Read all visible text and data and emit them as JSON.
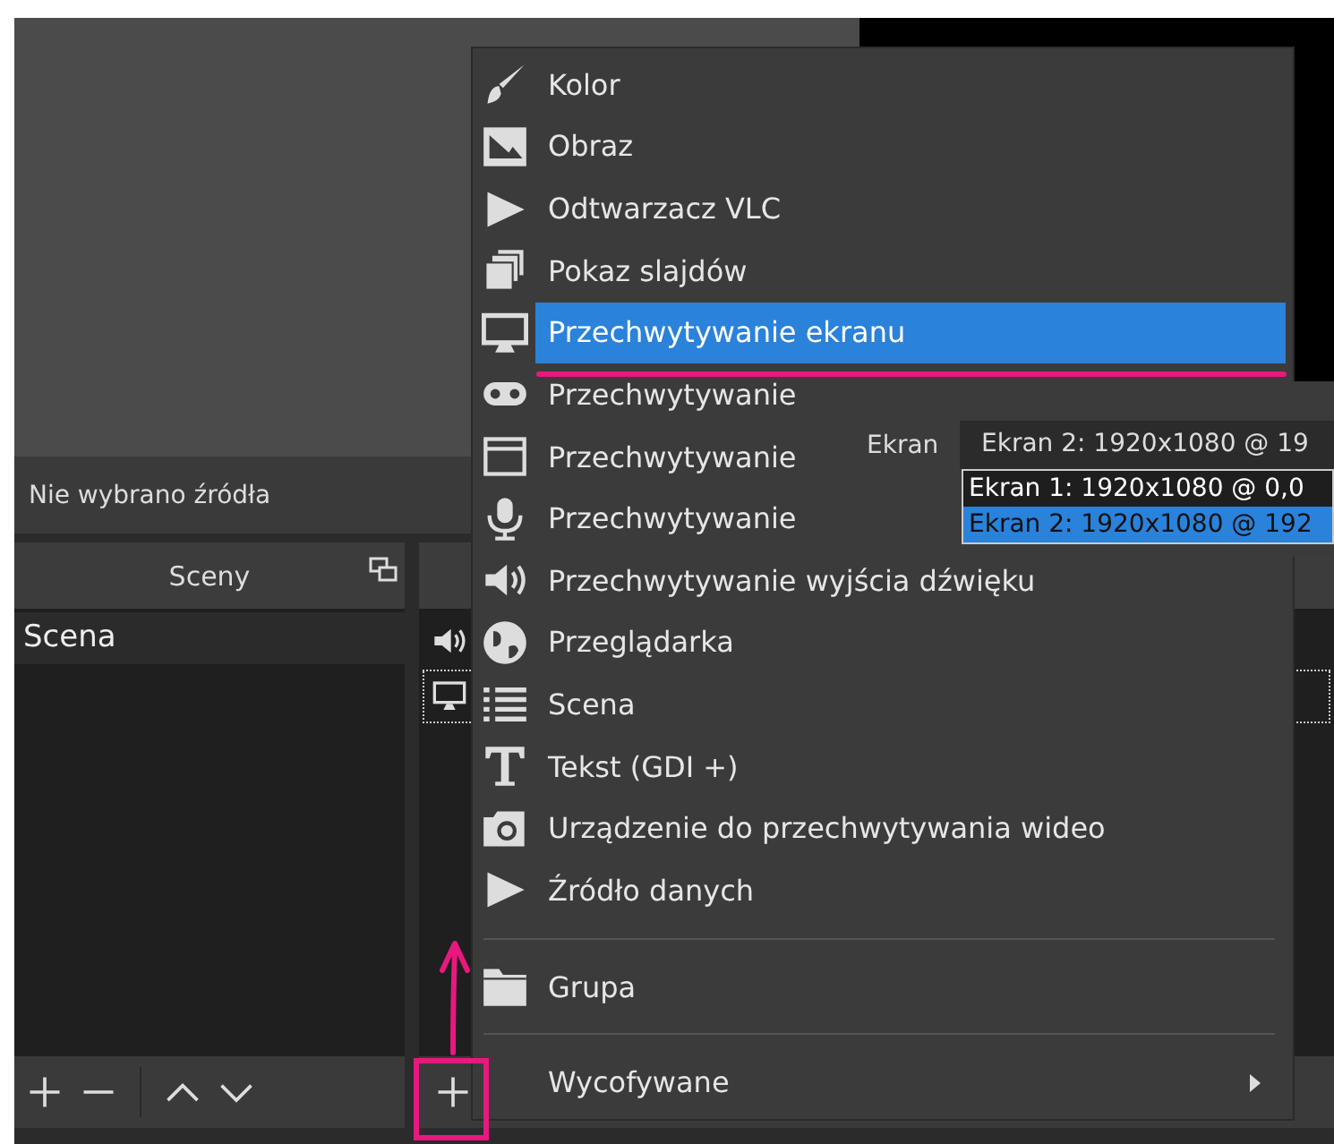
{
  "status_text": "Nie wybrano źródła",
  "scenes": {
    "title": "Sceny",
    "items": [
      {
        "label": "Scena",
        "selected": true
      }
    ]
  },
  "sources": {
    "items": [
      {
        "kind": "audio",
        "focused": false
      },
      {
        "kind": "display",
        "focused": true
      }
    ]
  },
  "menu": {
    "items": [
      {
        "kind": "brush",
        "label": "Kolor",
        "selected": false
      },
      {
        "kind": "image",
        "label": "Obraz",
        "selected": false
      },
      {
        "kind": "play",
        "label": "Odtwarzacz VLC",
        "selected": false
      },
      {
        "kind": "slides",
        "label": "Pokaz slajdów",
        "selected": false
      },
      {
        "kind": "monitor",
        "label": "Przechwytywanie ekranu",
        "selected": true
      },
      {
        "kind": "gamepad",
        "label": "Przechwytywanie",
        "selected": false
      },
      {
        "kind": "window",
        "label": "Przechwytywanie",
        "selected": false
      },
      {
        "kind": "mic",
        "label": "Przechwytywanie",
        "selected": false
      },
      {
        "kind": "speaker",
        "label": "Przechwytywanie wyjścia dźwięku",
        "selected": false
      },
      {
        "kind": "globe",
        "label": "Przeglądarka",
        "selected": false
      },
      {
        "kind": "list",
        "label": "Scena",
        "selected": false
      },
      {
        "kind": "text",
        "label": "Tekst (GDI +)",
        "selected": false
      },
      {
        "kind": "camera",
        "label": "Urządzenie do przechwytywania wideo",
        "selected": false
      },
      {
        "kind": "play",
        "label": "Źródło danych",
        "selected": false
      },
      {
        "kind": "separator"
      },
      {
        "kind": "folder",
        "label": "Grupa",
        "selected": false
      },
      {
        "kind": "separator"
      },
      {
        "kind": "submenu",
        "label": "Wycofywane",
        "selected": false
      }
    ]
  },
  "popover": {
    "label": "Ekran",
    "value": "Ekran 2: 1920x1080 @ 19",
    "options": [
      {
        "label": "Ekran 1: 1920x1080 @ 0,0",
        "selected": false
      },
      {
        "label": "Ekran 2: 1920x1080 @ 192",
        "selected": true
      }
    ]
  }
}
